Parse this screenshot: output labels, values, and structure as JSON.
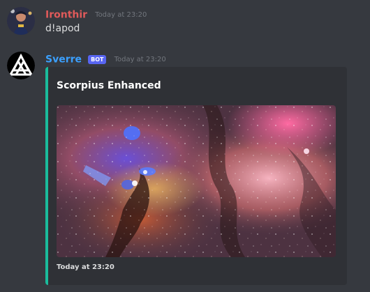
{
  "messages": [
    {
      "author": "Ironthir",
      "author_color": "#e05a5a",
      "timestamp": "Today at 23:20",
      "content": "d!apod"
    },
    {
      "author": "Sverre",
      "author_color": "#3ba0ff",
      "badge": "BOT",
      "timestamp": "Today at 23:20",
      "embed": {
        "accent_color": "#1abc9c",
        "title": "Scorpius Enhanced",
        "footer": "Today at 23:20"
      }
    }
  ]
}
